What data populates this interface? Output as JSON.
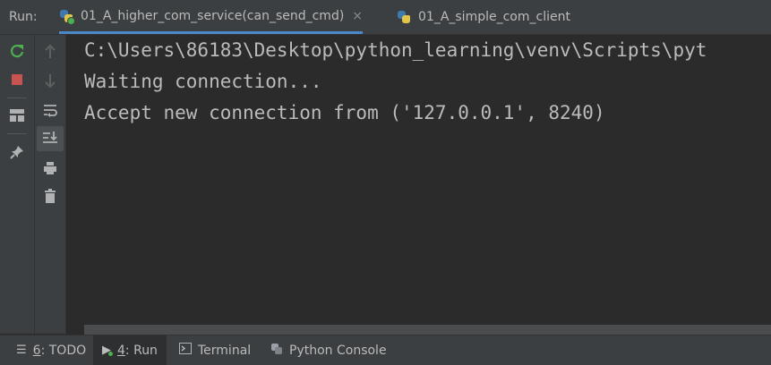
{
  "run_label": "Run:",
  "tabs": [
    {
      "label": "01_A_higher_com_service(can_send_cmd)",
      "active": true,
      "close": "×"
    },
    {
      "label": "01_A_simple_com_client",
      "active": false
    }
  ],
  "console_lines": [
    "C:\\Users\\86183\\Desktop\\python_learning\\venv\\Scripts\\pyt",
    "Waiting connection...",
    "Accept new connection from ('127.0.0.1', 8240)"
  ],
  "bottom_tabs": [
    {
      "number": "6",
      "label": ": TODO",
      "icon": "list-icon"
    },
    {
      "number": "4",
      "label": ": Run",
      "icon": "run-icon",
      "active": true
    },
    {
      "label": "Terminal",
      "icon": "terminal-icon"
    },
    {
      "label": "Python Console",
      "icon": "python-icon"
    }
  ],
  "colors": {
    "accent": "#4a88c7",
    "rerun": "#4caf50",
    "stop": "#c75450"
  }
}
